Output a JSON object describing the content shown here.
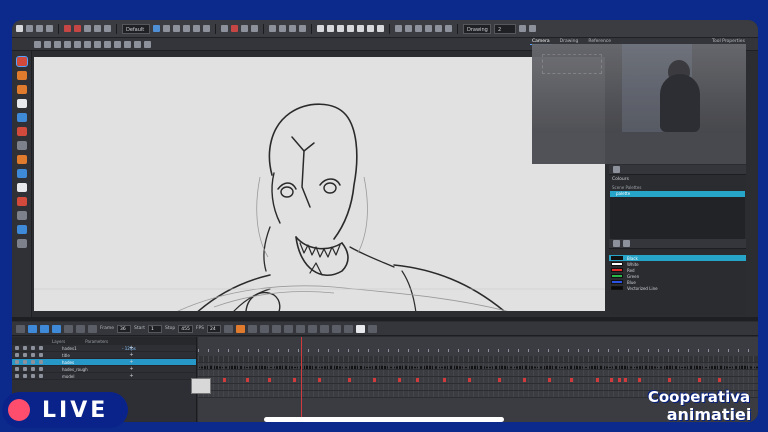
{
  "stream": {
    "live_label": "LIVE",
    "brand_line1": "Cooperativa",
    "brand_line2": "animatiei"
  },
  "toolbar": {
    "view_dropdown": "Default",
    "zoom_dropdown": "Drawing",
    "zoom_value": "2"
  },
  "view_tabs": [
    "Camera",
    "Drawing",
    "Reference"
  ],
  "properties_tab": "Tool Properties",
  "colours_panel": {
    "title": "Colours",
    "scene_palettes_label": "Scene Palettes",
    "selected_palette": "palette",
    "swatches": [
      {
        "name": "Black",
        "color": "#111111"
      },
      {
        "name": "White",
        "color": "#ffffff"
      },
      {
        "name": "Red",
        "color": "#e22a2a"
      },
      {
        "name": "Green",
        "color": "#2bb84a"
      },
      {
        "name": "Blue",
        "color": "#2b52e2"
      },
      {
        "name": "Vectorized Line",
        "color": "#0a0a0a"
      }
    ]
  },
  "timeline": {
    "frame_label": "Frame",
    "frame_value": "36",
    "start_label": "Start",
    "start_value": "1",
    "stop_label": "Stop",
    "stop_value": "455",
    "fps_label": "FPS",
    "fps_value": "24",
    "header_labels": [
      "Layers",
      "Parameters"
    ],
    "layers": [
      {
        "name": "hades1",
        "extra": "- 12fps"
      },
      {
        "name": "title",
        "extra": ""
      },
      {
        "name": "hades",
        "extra": ""
      },
      {
        "name": "hades_rough",
        "extra": ""
      },
      {
        "name": "model",
        "extra": ""
      }
    ],
    "selected_layer": 2
  },
  "colors": {
    "accent": "#27a5c9",
    "live_dot": "#ff4d6d",
    "stream_bg": "#0b2a8c"
  }
}
